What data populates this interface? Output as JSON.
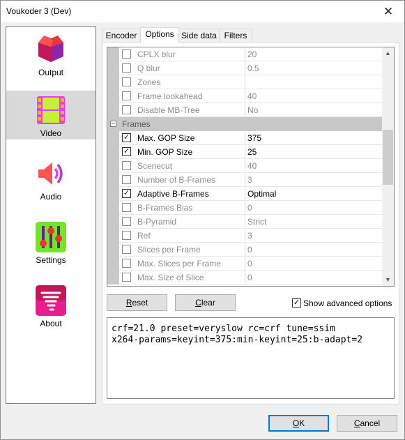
{
  "window": {
    "title": "Voukoder 3 (Dev)",
    "close_glyph": "✕"
  },
  "nav": {
    "items": [
      {
        "label": "Output",
        "icon": "output-box-icon"
      },
      {
        "label": "Video",
        "icon": "video-film-icon",
        "selected": true
      },
      {
        "label": "Audio",
        "icon": "audio-speaker-icon"
      },
      {
        "label": "Settings",
        "icon": "settings-sliders-icon"
      },
      {
        "label": "About",
        "icon": "about-tornado-icon"
      }
    ]
  },
  "tabs": [
    "Encoder",
    "Options",
    "Side data",
    "Filters"
  ],
  "active_tab": "Options",
  "grid": {
    "rows": [
      {
        "type": "prop",
        "name": "CPLX blur",
        "value": "20",
        "checked": false,
        "enabled": false
      },
      {
        "type": "prop",
        "name": "Q blur",
        "value": "0.5",
        "checked": false,
        "enabled": false
      },
      {
        "type": "prop",
        "name": "Zones",
        "value": "",
        "checked": false,
        "enabled": false
      },
      {
        "type": "prop",
        "name": "Frame lookahead",
        "value": "40",
        "checked": false,
        "enabled": false
      },
      {
        "type": "prop",
        "name": "Disable MB-Tree",
        "value": "No",
        "checked": false,
        "enabled": false
      },
      {
        "type": "category",
        "name": "Frames",
        "expander": "−"
      },
      {
        "type": "prop",
        "name": "Max. GOP Size",
        "value": "375",
        "checked": true,
        "enabled": true
      },
      {
        "type": "prop",
        "name": "Min. GOP Size",
        "value": "25",
        "checked": true,
        "enabled": true
      },
      {
        "type": "prop",
        "name": "Scenecut",
        "value": "40",
        "checked": false,
        "enabled": false
      },
      {
        "type": "prop",
        "name": "Number of B-Frames",
        "value": "3",
        "checked": false,
        "enabled": false
      },
      {
        "type": "prop",
        "name": "Adaptive B-Frames",
        "value": "Optimal",
        "checked": true,
        "enabled": true
      },
      {
        "type": "prop",
        "name": "B-Frames Bias",
        "value": "0",
        "checked": false,
        "enabled": false
      },
      {
        "type": "prop",
        "name": "B-Pyramid",
        "value": "Strict",
        "checked": false,
        "enabled": false
      },
      {
        "type": "prop",
        "name": "Ref",
        "value": "3",
        "checked": false,
        "enabled": false
      },
      {
        "type": "prop",
        "name": "Slices per Frame",
        "value": "0",
        "checked": false,
        "enabled": false
      },
      {
        "type": "prop",
        "name": "Max. Slices per Frame",
        "value": "0",
        "checked": false,
        "enabled": false
      },
      {
        "type": "prop",
        "name": "Max. Size of Slice",
        "value": "0",
        "checked": false,
        "enabled": false
      }
    ],
    "scroll_up": "▲",
    "scroll_down": "▼",
    "check_glyph": "✓"
  },
  "buttons": {
    "reset_mnemonic": "R",
    "reset_rest": "eset",
    "clear_mnemonic": "C",
    "clear_rest": "lear",
    "ok_mnemonic": "O",
    "ok_rest": "K",
    "cancel_mnemonic": "C",
    "cancel_rest": "ancel"
  },
  "show_advanced": {
    "label": "Show advanced options",
    "checked": true
  },
  "command_line": "crf=21.0 preset=veryslow rc=crf tune=ssim\nx264-params=keyint=375:min-keyint=25:b-adapt=2"
}
